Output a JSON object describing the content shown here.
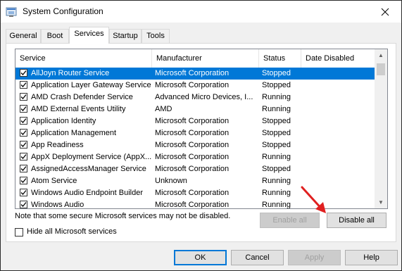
{
  "window": {
    "title": "System Configuration",
    "close_label": "×"
  },
  "tabs": [
    "General",
    "Boot",
    "Services",
    "Startup",
    "Tools"
  ],
  "columns": [
    "Service",
    "Manufacturer",
    "Status",
    "Date Disabled"
  ],
  "services": [
    {
      "name": "AllJoyn Router Service",
      "manufacturer": "Microsoft Corporation",
      "status": "Stopped",
      "date": "",
      "checked": true,
      "selected": true
    },
    {
      "name": "Application Layer Gateway Service",
      "manufacturer": "Microsoft Corporation",
      "status": "Stopped",
      "date": "",
      "checked": true,
      "selected": false
    },
    {
      "name": "AMD Crash Defender Service",
      "manufacturer": "Advanced Micro Devices, I...",
      "status": "Running",
      "date": "",
      "checked": true,
      "selected": false
    },
    {
      "name": "AMD External Events Utility",
      "manufacturer": "AMD",
      "status": "Running",
      "date": "",
      "checked": true,
      "selected": false
    },
    {
      "name": "Application Identity",
      "manufacturer": "Microsoft Corporation",
      "status": "Stopped",
      "date": "",
      "checked": true,
      "selected": false
    },
    {
      "name": "Application Management",
      "manufacturer": "Microsoft Corporation",
      "status": "Stopped",
      "date": "",
      "checked": true,
      "selected": false
    },
    {
      "name": "App Readiness",
      "manufacturer": "Microsoft Corporation",
      "status": "Stopped",
      "date": "",
      "checked": true,
      "selected": false
    },
    {
      "name": "AppX Deployment Service (AppX...",
      "manufacturer": "Microsoft Corporation",
      "status": "Running",
      "date": "",
      "checked": true,
      "selected": false
    },
    {
      "name": "AssignedAccessManager Service",
      "manufacturer": "Microsoft Corporation",
      "status": "Stopped",
      "date": "",
      "checked": true,
      "selected": false
    },
    {
      "name": "Atom Service",
      "manufacturer": "Unknown",
      "status": "Running",
      "date": "",
      "checked": true,
      "selected": false
    },
    {
      "name": "Windows Audio Endpoint Builder",
      "manufacturer": "Microsoft Corporation",
      "status": "Running",
      "date": "",
      "checked": true,
      "selected": false
    },
    {
      "name": "Windows Audio",
      "manufacturer": "Microsoft Corporation",
      "status": "Running",
      "date": "",
      "checked": true,
      "selected": false
    }
  ],
  "note": "Note that some secure Microsoft services may not be disabled.",
  "buttons": {
    "enable_all": "Enable all",
    "disable_all": "Disable all",
    "ok": "OK",
    "cancel": "Cancel",
    "apply": "Apply",
    "help": "Help"
  },
  "hide_ms_label": "Hide all Microsoft services",
  "colors": {
    "selection": "#0078d7",
    "arrow": "#e02020",
    "default_button_border": "#0078d7"
  }
}
